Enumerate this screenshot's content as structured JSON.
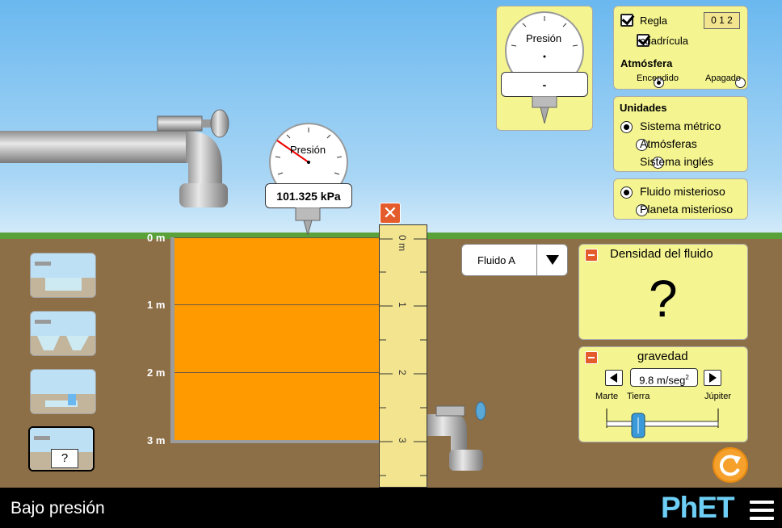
{
  "footer": {
    "title": "Bajo presión",
    "logo": "PhET"
  },
  "pool": {
    "depth_labels": [
      "0 m",
      "1 m",
      "2 m",
      "3 m"
    ],
    "fluid_color": "#ff9a00"
  },
  "ruler": {
    "labels": [
      "0 m",
      "1",
      "2",
      "3"
    ]
  },
  "pool_gauge": {
    "label": "Presión",
    "value": "101.325 kPa"
  },
  "toolbox_gauge": {
    "label": "Presión",
    "value": "-"
  },
  "options_panel": {
    "ruler_label": "Regla",
    "ruler_icon_digits": "0 1 2",
    "grid_label": "cuadrícula",
    "atmosphere_title": "Atmósfera",
    "atmosphere_on": "Encendido",
    "atmosphere_off": "Apagado"
  },
  "units_panel": {
    "title": "Unidades",
    "options": [
      "Sistema métrico",
      "Atmósferas",
      "Sistema inglés"
    ],
    "selected": "Sistema métrico"
  },
  "mystery_panel": {
    "options": [
      "Fluido misterioso",
      "Planeta misterioso"
    ],
    "selected": "Fluido misterioso"
  },
  "fluid_select": {
    "value": "Fluido A"
  },
  "density_panel": {
    "title": "Densidad del fluido",
    "value": "?"
  },
  "gravity_panel": {
    "title": "gravedad",
    "value": "9.8 m/seg",
    "unit_exp": "2",
    "labels": [
      "Marte",
      "Tierra",
      "Júpiter"
    ]
  },
  "scenes": {
    "mystery_label": "?"
  },
  "colors": {
    "panel": "#f4f490",
    "accent": "#e45c2b",
    "phet_blue": "#6ecff6"
  }
}
